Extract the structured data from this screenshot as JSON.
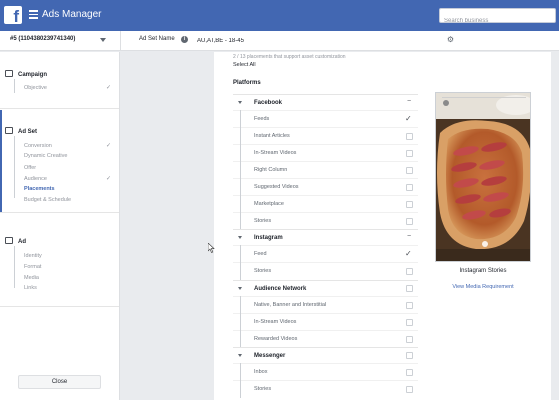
{
  "app": {
    "title": "Ads Manager",
    "search_placeholder": "Search business"
  },
  "header": {
    "account": "#5 (1104380239741340)",
    "ad_set_name_label": "Ad Set Name",
    "ad_set_name_value": "AU,AT,BE - 18-45"
  },
  "sidebar": {
    "campaign": {
      "heading": "Campaign",
      "items": [
        {
          "label": "Objective",
          "done": true
        }
      ]
    },
    "ad_set": {
      "heading": "Ad Set",
      "items": [
        {
          "label": "Conversion",
          "done": true
        },
        {
          "label": "Dynamic Creative",
          "done": false
        },
        {
          "label": "Offer",
          "done": false
        },
        {
          "label": "Audience",
          "done": true
        },
        {
          "label": "Placements",
          "done": false,
          "active": true
        },
        {
          "label": "Budget & Schedule",
          "done": false
        }
      ]
    },
    "ad": {
      "heading": "Ad",
      "items": [
        {
          "label": "Identity"
        },
        {
          "label": "Format"
        },
        {
          "label": "Media"
        },
        {
          "label": "Links"
        }
      ]
    },
    "close_label": "Close"
  },
  "placements": {
    "note": "2 / 13 placements that support asset customization",
    "select_all": "Select All",
    "platforms_label": "Platforms",
    "groups": [
      {
        "name": "Facebook",
        "state": "partial",
        "items": [
          {
            "label": "Feeds",
            "checked": true
          },
          {
            "label": "Instant Articles",
            "checked": false
          },
          {
            "label": "In-Stream Videos",
            "checked": false
          },
          {
            "label": "Right Column",
            "checked": false
          },
          {
            "label": "Suggested Videos",
            "checked": false
          },
          {
            "label": "Marketplace",
            "checked": false
          },
          {
            "label": "Stories",
            "checked": false
          }
        ]
      },
      {
        "name": "Instagram",
        "state": "partial",
        "items": [
          {
            "label": "Feed",
            "checked": true
          },
          {
            "label": "Stories",
            "checked": false
          }
        ]
      },
      {
        "name": "Audience Network",
        "state": "none",
        "items": [
          {
            "label": "Native, Banner and Interstitial",
            "checked": false
          },
          {
            "label": "In-Stream Videos",
            "checked": false
          },
          {
            "label": "Rewarded Videos",
            "checked": false
          }
        ]
      },
      {
        "name": "Messenger",
        "state": "none",
        "items": [
          {
            "label": "Inbox",
            "checked": false
          },
          {
            "label": "Stories",
            "checked": false
          }
        ]
      }
    ]
  },
  "preview": {
    "title": "Instagram Stories",
    "link": "View Media Requirement"
  },
  "colors": {
    "brand": "#4267b2",
    "background": "#e9ebee"
  }
}
